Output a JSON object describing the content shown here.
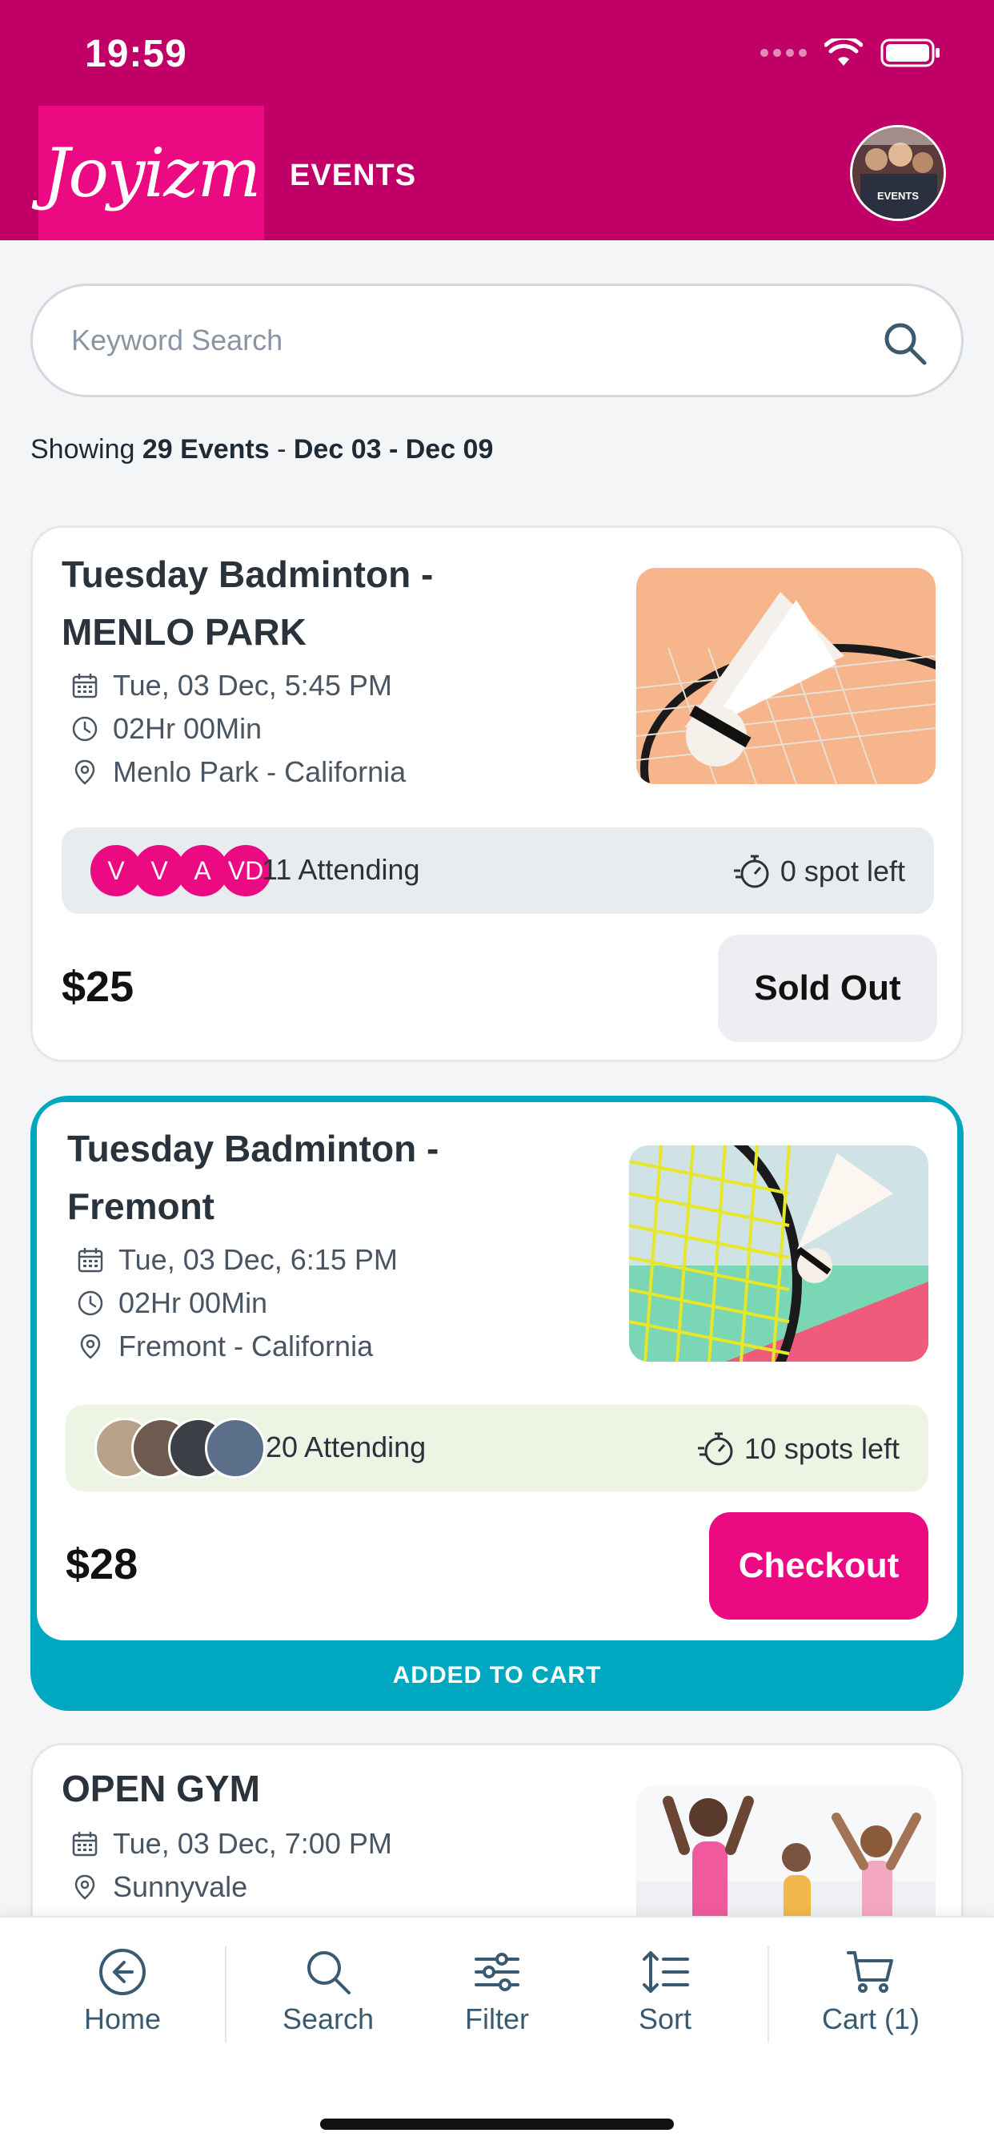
{
  "status": {
    "time": "19:59"
  },
  "header": {
    "logo": "Joyizm",
    "title": "EVENTS",
    "avatar_caption": "EVENTS"
  },
  "search": {
    "placeholder": "Keyword Search",
    "value": ""
  },
  "summary": {
    "prefix": "Showing",
    "count": "29 Events",
    "separator": "-",
    "range": "Dec 03 - Dec 09"
  },
  "events": [
    {
      "title_line1": "Tuesday Badminton -",
      "title_line2": "MENLO PARK",
      "date": "Tue, 03 Dec, 5:45 PM",
      "duration": "02Hr 00Min",
      "location": "Menlo Park - California",
      "attendee_initials": [
        "V",
        "V",
        "A",
        "VD"
      ],
      "attending": "11 Attending",
      "spots": "0 spot left",
      "price": "$25",
      "button": "Sold Out"
    },
    {
      "title_line1": "Tuesday Badminton -",
      "title_line2": "Fremont",
      "date": "Tue, 03 Dec, 6:15 PM",
      "duration": "02Hr 00Min",
      "location": "Fremont - California",
      "attending": "20 Attending",
      "spots": "10 spots left",
      "price": "$28",
      "button": "Checkout",
      "banner": "ADDED TO CART"
    },
    {
      "title_line1": "OPEN GYM",
      "date": "Tue, 03 Dec, 7:00 PM",
      "location": "Sunnyvale"
    }
  ],
  "nav": [
    {
      "label": "Home",
      "icon": "arrow-left-circle-icon"
    },
    {
      "label": "Search",
      "icon": "search-icon"
    },
    {
      "label": "Filter",
      "icon": "sliders-icon"
    },
    {
      "label": "Sort",
      "icon": "sort-icon"
    },
    {
      "label": "Cart (1)",
      "icon": "cart-icon"
    }
  ],
  "colors": {
    "brand": "#c10067",
    "accent": "#ec0a82",
    "cart_teal": "#00a7c0",
    "sold_out_bg": "#eceef1"
  }
}
